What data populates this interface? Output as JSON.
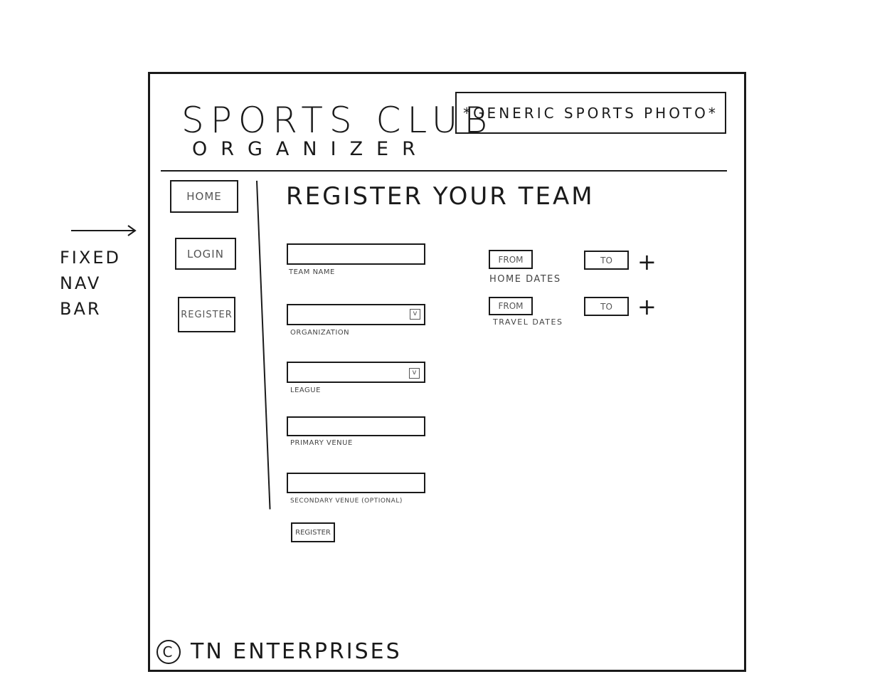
{
  "header": {
    "title": "SPORTS CLUB",
    "subtitle": "ORGANIZER",
    "photo_placeholder": "*GENERIC SPORTS PHOTO*"
  },
  "nav": {
    "items": [
      {
        "label": "HOME"
      },
      {
        "label": "LOGIN"
      },
      {
        "label": "REGISTER"
      }
    ]
  },
  "main": {
    "heading": "REGISTER YOUR TEAM",
    "fields": [
      {
        "label": "TEAM NAME",
        "type": "text",
        "value": ""
      },
      {
        "label": "ORGANIZATION",
        "type": "select",
        "value": "",
        "icon": "chevron-down-icon"
      },
      {
        "label": "LEAGUE",
        "type": "select",
        "value": "",
        "icon": "chevron-down-icon"
      },
      {
        "label": "PRIMARY VENUE",
        "type": "text",
        "value": ""
      },
      {
        "label": "SECONDARY VENUE (OPTIONAL)",
        "type": "text",
        "value": ""
      }
    ],
    "date_ranges": [
      {
        "label": "HOME DATES",
        "from_label": "FROM",
        "to_label": "TO",
        "add_label": "+"
      },
      {
        "label": "TRAVEL DATES",
        "from_label": "FROM",
        "to_label": "TO",
        "add_label": "+"
      }
    ],
    "submit_label": "REGISTER"
  },
  "footer": {
    "symbol": "C",
    "text": "TN ENTERPRISES"
  },
  "annotation": {
    "lines": [
      "FIXED",
      "NAV",
      "BAR"
    ],
    "arrow": "→"
  }
}
